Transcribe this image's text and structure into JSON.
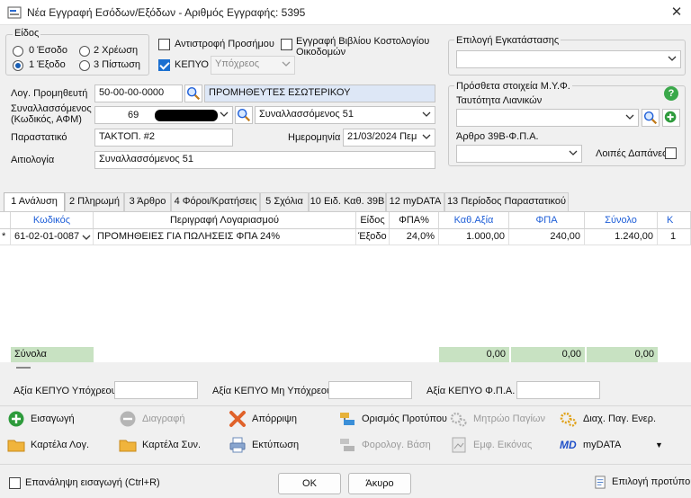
{
  "window": {
    "title": "Νέα Εγγραφή Εσόδων/Εξόδων - Αριθμός Εγγραφής: 5395"
  },
  "eidos": {
    "legend": "Είδος",
    "options": [
      "0 Έσοδο",
      "2 Χρέωση",
      "1 Έξοδο",
      "3 Πίστωση"
    ],
    "selected": "1 Έξοδο"
  },
  "checks": {
    "antistrofi": "Αντιστροφή Προσήμου",
    "kepyo": "ΚΕΠΥΟ",
    "kepyo_combo": "Υπόχρεος",
    "vivlio": "Εγγραφή Βιβλίου Κοστολογίου Οικοδομών"
  },
  "epilogi": {
    "label": "Επιλογή Εγκατάστασης",
    "value": ""
  },
  "form": {
    "log_prom_label": "Λογ. Προμηθευτή",
    "log_prom_value": "50-00-00-0000",
    "log_prom_name": "ΠΡΟΜΗΘΕΥΤΕΣ ΕΣΩΤΕΡΙΚΟΥ",
    "synal_label": "Συναλλασσόμενος (Κωδικός, ΑΦΜ)",
    "synal_code": "69",
    "synal_name": "Συναλλασσόμενος 51",
    "parast_label": "Παραστατικό",
    "parast_value": "ΤΑΚΤΟΠ. #2",
    "date_label": "Ημερομηνία",
    "date_value": "21/03/2024 Πεμ",
    "aitiologia_label": "Αιτιολογία",
    "aitiologia_value": "Συναλλασσόμενος 51"
  },
  "myf": {
    "legend": "Πρόσθετα στοιχεία Μ.Υ.Φ.",
    "taut_label": "Ταυτότητα Λιανικών",
    "taut_value": "",
    "arthro_label": "Άρθρο 39Β-Φ.Π.Α.",
    "arthro_value": "",
    "loipes_label": "Λοιπές Δαπάνες"
  },
  "tabs": [
    "1 Ανάλυση",
    "2 Πληρωμή",
    "3 Άρθρο",
    "4 Φόροι/Κρατήσεις",
    "5 Σχόλια",
    "10 Ειδ. Καθ. 39Β",
    "12 myDATA",
    "13 Περίοδος Παραστατικού"
  ],
  "grid": {
    "headers": [
      "Κωδικός",
      "Περιγραφή Λογαριασμού",
      "Είδος",
      "ΦΠΑ%",
      "Καθ.Αξία",
      "ΦΠΑ",
      "Σύνολο",
      "Κ"
    ],
    "row": {
      "marker": "*",
      "code": "61-02-01-0087",
      "desc": "ΠΡΟΜΗΘΕΙΕΣ ΓΙΑ ΠΩΛΗΣΕΙΣ ΦΠΑ 24%",
      "eidos": "Έξοδο",
      "fpa_pct": "24,0%",
      "kath": "1.000,00",
      "fpa": "240,00",
      "synolo": "1.240,00",
      "k": "1"
    },
    "totals_label": "Σύνολα",
    "totals": [
      "0,00",
      "0,00",
      "0,00"
    ]
  },
  "kepyo_values": {
    "ypoxreou_label": "Αξία ΚΕΠΥΟ Υπόχρεου",
    "mi_ypoxreou_label": "Αξία ΚΕΠΥΟ Μη Υπόχρεου",
    "fpa_label": "Αξία ΚΕΠΥΟ Φ.Π.Α.",
    "ypoxreou": "",
    "mi_ypoxreou": "",
    "fpa": ""
  },
  "actions": {
    "eisagogi": "Εισαγωγή",
    "diagrafi": "Διαγραφή",
    "aporripsi": "Απόρριψη",
    "orismos": "Ορισμός Προτύπου",
    "mitroo": "Μητρώο Παγίων",
    "diax": "Διαχ. Παγ. Ενερ.",
    "kartela_log": "Καρτέλα Λογ.",
    "kartela_syn": "Καρτέλα Συν.",
    "ektyposi": "Εκτύπωση",
    "forolog": "Φορολογ. Βάση",
    "emf": "Εμφ. Εικόνας",
    "mydata": "myDATA"
  },
  "footer": {
    "repeat_label": "Επανάληψη εισαγωγή (Ctrl+R)",
    "ok": "OK",
    "cancel": "Άκυρο",
    "template": "Επιλογή προτύπου"
  },
  "colors": {
    "accent": "#1a6fd0",
    "totals_bg": "#c8e2c2",
    "name_bg": "#dde7f6"
  }
}
